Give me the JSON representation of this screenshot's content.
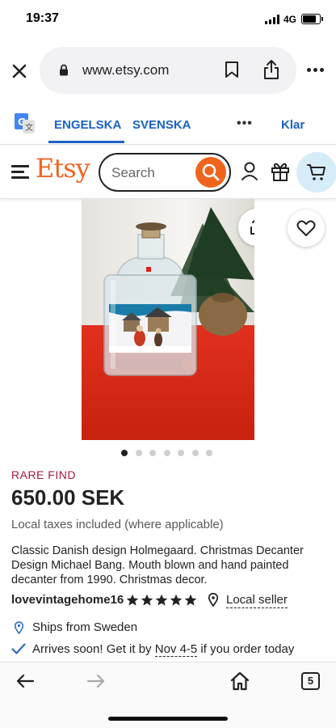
{
  "status_bar": {
    "time": "19:37",
    "network": "4G",
    "battery_level": 0.85
  },
  "browser": {
    "url": "www.etsy.com",
    "icons": [
      "close-icon",
      "lock-icon",
      "bookmark-icon",
      "share-icon",
      "more-icon"
    ]
  },
  "translate_bar": {
    "source_language": "ENGELSKA",
    "target_language": "SVENSKA",
    "more": "•••",
    "done": "Klar",
    "active_tab": "ENGELSKA"
  },
  "etsy_header": {
    "logo": "Etsy",
    "search_placeholder": "Search",
    "brand_color": "#f1641e",
    "cart_bg_color": "#d7ecf9"
  },
  "product": {
    "image_count": 7,
    "current_image_index": 0,
    "badge": "RARE FIND",
    "badge_color": "#a61a3e",
    "price": "650.00 SEK",
    "tax_note": "Local taxes included (where applicable)",
    "description": "Classic Danish design Holmegaard. Christmas Decanter Design Michael Bang. Mouth blown and hand painted decanter from 1990. Christmas decor.",
    "shop_name": "lovevintagehome16",
    "rating_stars": 5,
    "local_seller_label": "Local seller",
    "ships_from": "Ships from Sweden",
    "arrival_prefix": "Arrives soon! Get it by ",
    "arrival_date": "Nov 4-5",
    "arrival_suffix": " if you order today"
  },
  "bottom_bar": {
    "tab_count": "5"
  }
}
